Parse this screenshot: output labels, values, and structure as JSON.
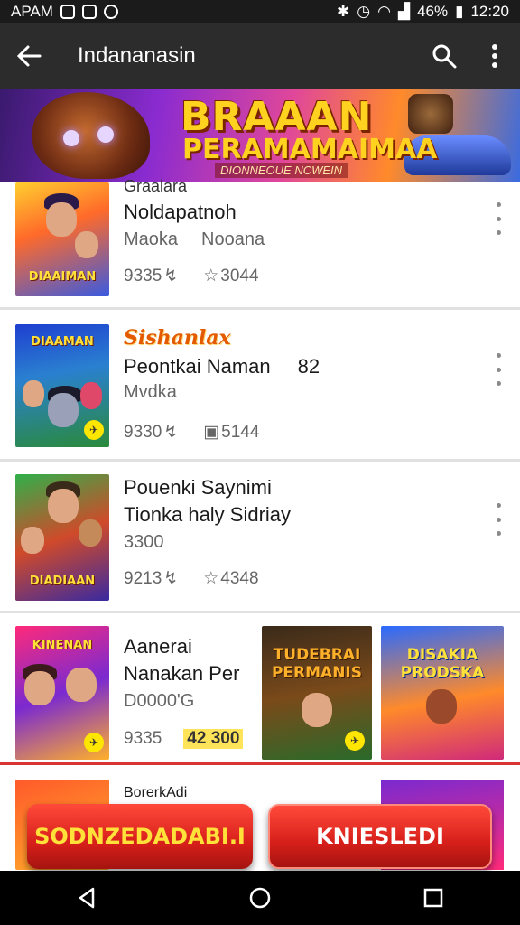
{
  "status_bar": {
    "carrier": "APAM",
    "battery": "46%",
    "time": "12:20"
  },
  "app_bar": {
    "title": "Indananasin",
    "back_icon": "arrow-left-icon",
    "search_icon": "search-icon",
    "menu_icon": "more-vert-icon"
  },
  "banner": {
    "title": "BRAAAN",
    "subtitle": "PERAMAMAIMAA",
    "tagline": "DIONNEOUE NCWEIN"
  },
  "items": [
    {
      "partial_title": "Graalara",
      "title": "Noldapatnoh",
      "sub": "Maoka",
      "sub2": "Nooana",
      "stat1": "9335",
      "stat2": "3044",
      "thumb_label": "DIAAIMAN"
    },
    {
      "promo": "Sishanlax",
      "title": "Peontkai Naman",
      "number": "82",
      "sub": "Mvdka",
      "stat1": "9330",
      "stat2": "5144",
      "thumb_label": "DIAAMAN"
    },
    {
      "title": "Pouenki Saynimi",
      "title2": "Tionka haly Sidriay",
      "sub": "3300",
      "stat1": "9213",
      "stat2": "4348",
      "thumb_label": "DIADIAAN"
    },
    {
      "title": "Aanerai",
      "title2": "Nanakan Per",
      "sub": "D0000'G",
      "stat1": "9335",
      "stat2": "42 300",
      "thumb_label": "KINENAN",
      "tiles": [
        {
          "label": "TUDEBRAI PERMANIS"
        },
        {
          "label": "DISAKIA PRODSKA"
        }
      ]
    }
  ],
  "partial_item": {
    "title": "BorerkAdi"
  },
  "actions": {
    "primary": "SODNZEDADABI.I",
    "secondary": "KNIESLEDI"
  },
  "nav": {
    "back_icon": "back-triangle-icon",
    "home_icon": "home-circle-icon",
    "recents_icon": "recents-square-icon"
  }
}
